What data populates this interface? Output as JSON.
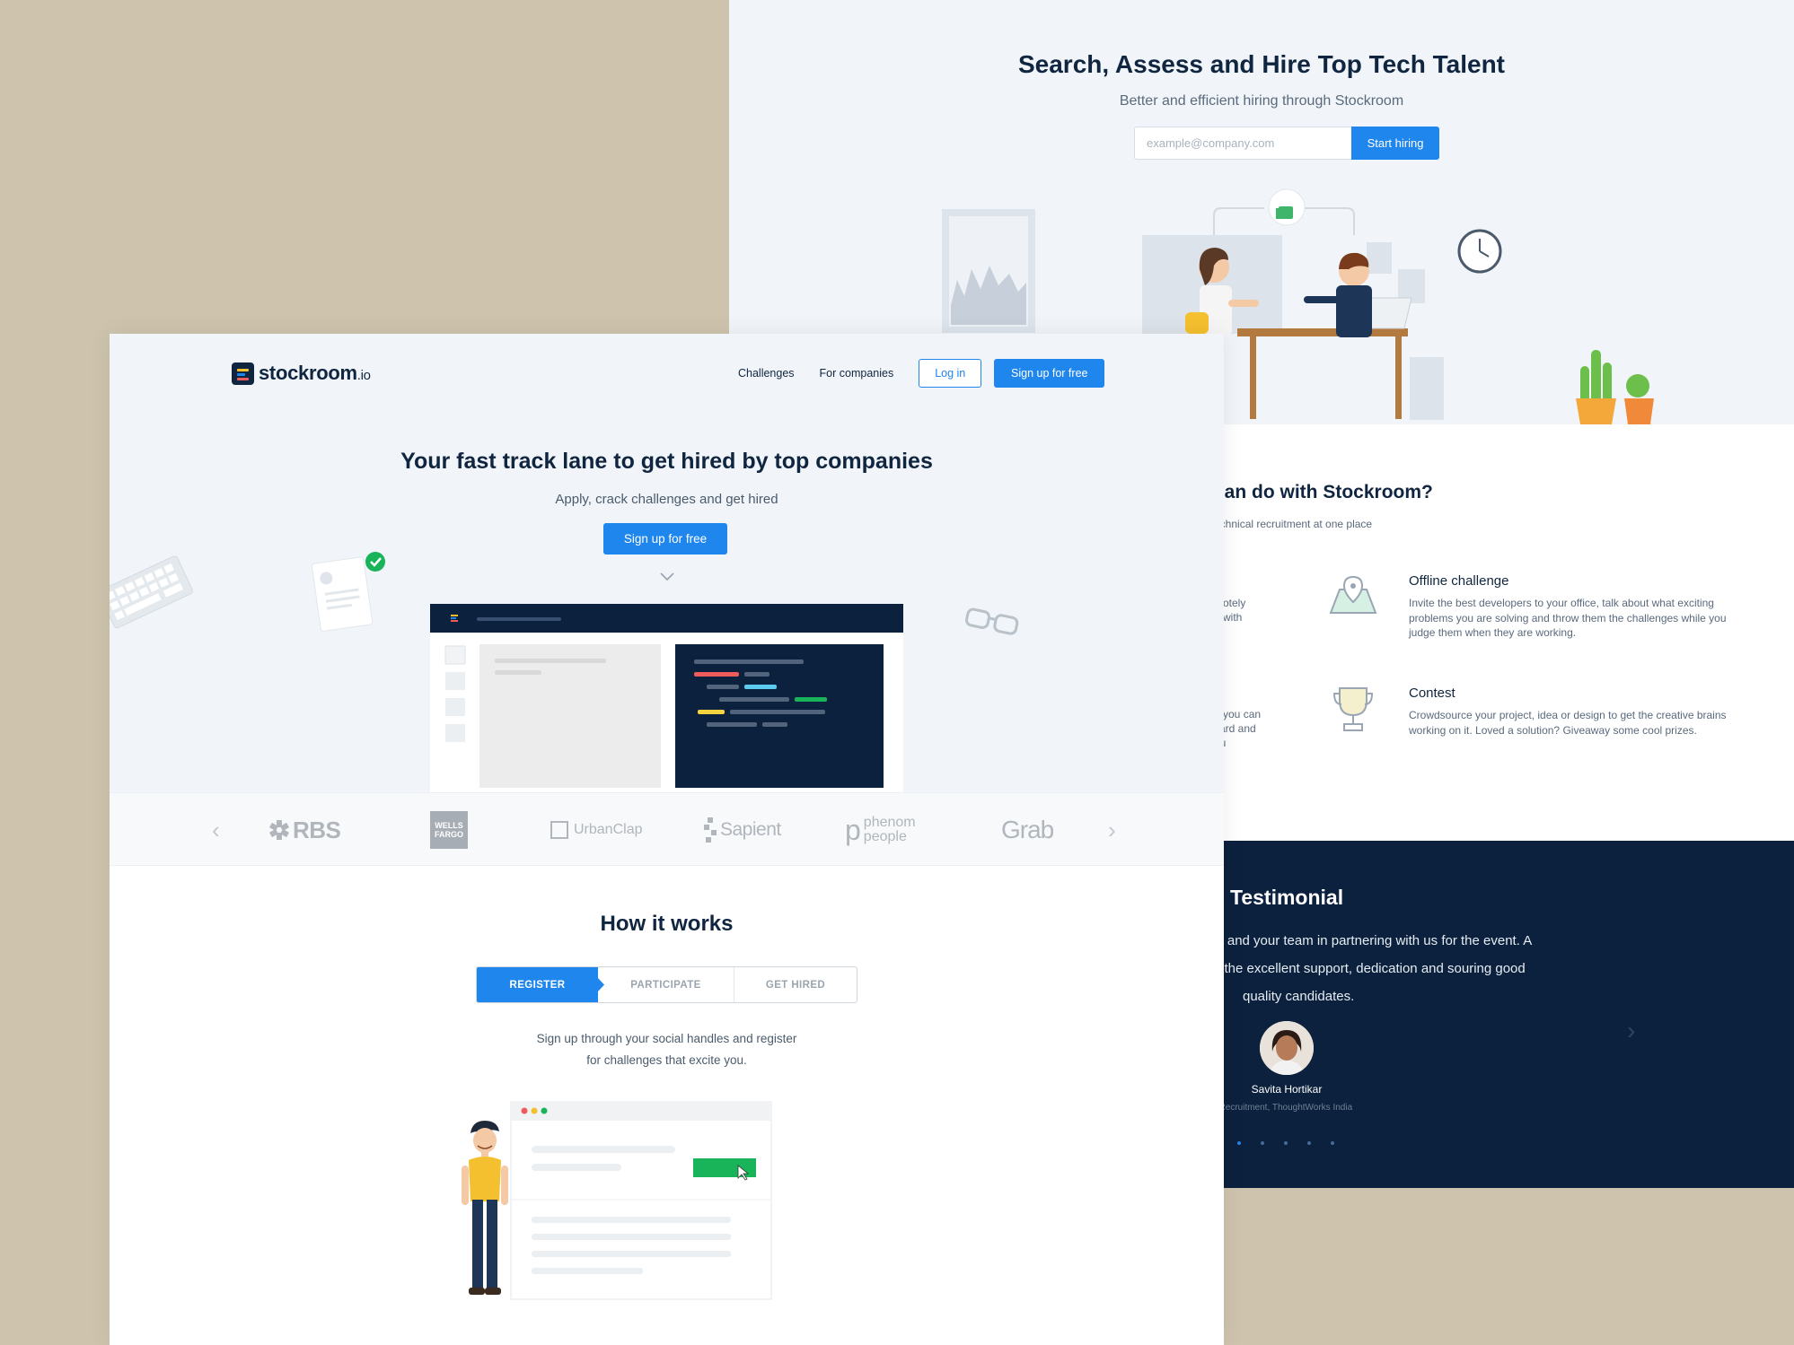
{
  "companies_page": {
    "title": "Search, Assess and Hire Top Tech Talent",
    "subtitle": "Better and efficient hiring through Stockroom",
    "email_placeholder": "example@company.com",
    "start_button": "Start hiring",
    "features": {
      "heading_partial": "can do with Stockroom?",
      "subheading_partial": "echnical recruitment at one place",
      "partial_left_1": [
        "motely",
        "e with"
      ],
      "partial_left_2": [
        "d you can",
        "card and",
        "ou"
      ],
      "items": [
        {
          "title": "Offline challenge",
          "description": "Invite the best developers to your office, talk about what exciting problems you are solving and throw them the challenges while you judge them when they are working."
        },
        {
          "title": "Contest",
          "description": "Crowdsource your project, idea or design to get the creative brains working on it. Loved a solution? Giveaway some cool prizes."
        }
      ]
    },
    "testimonial": {
      "heading": "Testimonial",
      "quote_lines": [
        "ou and your team in partnering with us for the event. A",
        "or the excellent support, dedication and souring good",
        "quality candidates."
      ],
      "name": "Savita Hortikar",
      "role": "f Recruitment, ThoughtWorks India",
      "dots": 5,
      "active_dot": 0
    }
  },
  "candidate_page": {
    "brand": {
      "name": "stockroom",
      "suffix": ".io"
    },
    "nav": {
      "links": [
        "Challenges",
        "For companies"
      ],
      "login": "Log in",
      "signup": "Sign up for free"
    },
    "hero": {
      "title": "Your fast track lane to get hired by top companies",
      "subtitle": "Apply, crack challenges and get hired",
      "cta": "Sign up for free"
    },
    "clients": [
      "RBS",
      "WELLS FARGO",
      "UrbanClap",
      "Sapient",
      "phenom people",
      "Grab"
    ],
    "how_it_works": {
      "title": "How it works",
      "steps": [
        "REGISTER",
        "PARTICIPATE",
        "GET HIRED"
      ],
      "active_step": 0,
      "description_lines": [
        "Sign up through your social handles and register",
        "for challenges that excite you."
      ]
    }
  },
  "colors": {
    "background": "#cec4ae",
    "primary": "#1f86ee",
    "navy": "#0c213d",
    "hero_bg": "#f1f5fa",
    "success": "#19b35a"
  }
}
